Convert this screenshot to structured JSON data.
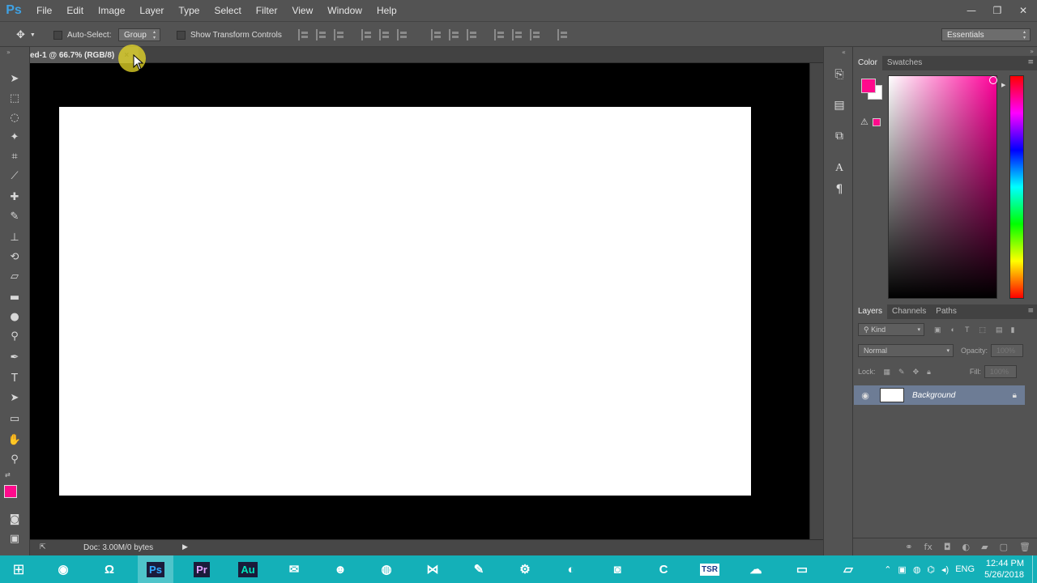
{
  "app": {
    "logo": "Ps"
  },
  "menu": [
    "File",
    "Edit",
    "Image",
    "Layer",
    "Type",
    "Select",
    "Filter",
    "View",
    "Window",
    "Help"
  ],
  "window_controls": {
    "minimize": "—",
    "restore": "❐",
    "close": "✕"
  },
  "options_bar": {
    "auto_select_label": "Auto-Select:",
    "auto_select_value": "Group",
    "show_transform_label": "Show Transform Controls",
    "workspace": "Essentials"
  },
  "document": {
    "tab_title": "ed-1 @ 66.7% (RGB/8)",
    "close": "×",
    "status": "Doc: 3.00M/0 bytes"
  },
  "colors": {
    "foreground": "#ff0a8c",
    "background": "#ffffff",
    "accent_selected_layer": "#6d7c95"
  },
  "color_panel": {
    "tabs": [
      "Color",
      "Swatches"
    ]
  },
  "layers_panel": {
    "tabs": [
      "Layers",
      "Channels",
      "Paths"
    ],
    "filter_kind": "Kind",
    "blend_mode": "Normal",
    "opacity_label": "Opacity:",
    "opacity_value": "100%",
    "lock_label": "Lock:",
    "fill_label": "Fill:",
    "fill_value": "100%",
    "layers": [
      {
        "name": "Background"
      }
    ]
  },
  "taskbar": {
    "apps": [
      {
        "name": "chrome",
        "glyph": "◉"
      },
      {
        "name": "magnet",
        "glyph": "Ω"
      },
      {
        "name": "photoshop",
        "glyph": "Ps"
      },
      {
        "name": "premiere",
        "glyph": "Pr"
      },
      {
        "name": "audition",
        "glyph": "Au"
      },
      {
        "name": "mail",
        "glyph": "✉"
      },
      {
        "name": "game",
        "glyph": "☻"
      },
      {
        "name": "globe",
        "glyph": "◍"
      },
      {
        "name": "visual-studio",
        "glyph": "⋈"
      },
      {
        "name": "paint",
        "glyph": "✎"
      },
      {
        "name": "settings",
        "glyph": "⚙"
      },
      {
        "name": "firefox",
        "glyph": "◐"
      },
      {
        "name": "recorder",
        "glyph": "◙"
      },
      {
        "name": "ccleaner",
        "glyph": "C"
      },
      {
        "name": "tsr-watermark",
        "glyph": "TSR"
      },
      {
        "name": "uc-browser",
        "glyph": "☁"
      },
      {
        "name": "explorer",
        "glyph": "▭"
      },
      {
        "name": "notepad",
        "glyph": "▱"
      }
    ],
    "language": "ENG",
    "time": "12:44 PM",
    "date": "5/26/2018"
  }
}
